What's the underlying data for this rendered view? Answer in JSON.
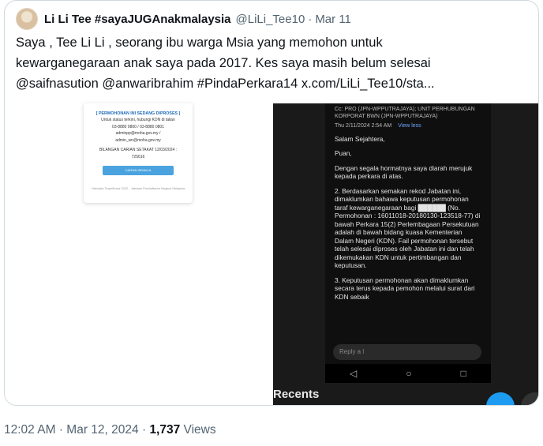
{
  "quoted_tweet": {
    "author_name": "Li Li Tee #sayaJUGAnakmalaysia",
    "author_handle": "@LiLi_Tee10",
    "separator": "·",
    "date": "Mar 11",
    "text_lines": [
      "Saya , Tee Li Li , seorang ibu warga Msia yang memohon untuk",
      "kewarganegaraan anak saya pada 2017. Kes saya masih belum selesai",
      "@saifnasution @anwaribrahim #PindaPerkara14  x.com/LiLi_Tee10/sta..."
    ],
    "media_left": {
      "title": "[ PERMOHONAN INI SEDANG DIPROSES ]",
      "line1": "Untuk status terkini, hubungi KDN di talian",
      "phone": "03-8880 0800 / 03-8880 0801",
      "email1": "adminpp@moha.gov.my /",
      "email2": "admin_wn@moha.gov.my",
      "count": "BILANGAN CARIAN SETAKAT 12/03/2024 :",
      "count_value": "725616",
      "button": "CARIAN SEMULA",
      "footer": "Hakcipta Terpelihara 2022 - Jabatan Pendaftaran Negara Malaysia"
    },
    "media_right": {
      "cc": "Cc: PRO (JPN-WPPUTRAJAYA); UNIT PERHUBUNGAN KORPORAT BWN (JPN-WPPUTRAJAYA)",
      "sent": "Thu 2/11/2024 2:54 AM",
      "view_less": "View less",
      "greeting": "Salam Sejahtera,",
      "salutation": "Puan,",
      "para1": "Dengan segala hormatnya saya diarah merujuk kepada perkara di atas.",
      "para2": "2.   Berdasarkan semakan rekod Jabatan ini, dimaklumkan bahawa keputusan permohonan taraf kewarganegaraan bagi ██████ (No. Permohonan : 16011018-20180130-123518-77) di bawah Perkara 15(2) Perlembagaan Persekutuan adalah di bawah bidang kuasa Kementerian Dalam Negeri (KDN). Fail permohonan tersebut telah selesai diproses oleh Jabatan ini dan telah dikemukakan KDN untuk pertimbangan dan keputusan.",
      "para3": "3.   Keputusan permohonan akan dimaklumkan secara terus kepada pemohon melalui surat dari KDN sebaik",
      "reply": "Reply a l",
      "nav_back": "◁",
      "nav_home": "○",
      "nav_recent": "□",
      "recents": "Recents"
    }
  },
  "footer": {
    "time": "12:02 AM",
    "separator": "·",
    "date": "Mar 12, 2024",
    "views_count": "1,737",
    "views_label": "Views"
  }
}
